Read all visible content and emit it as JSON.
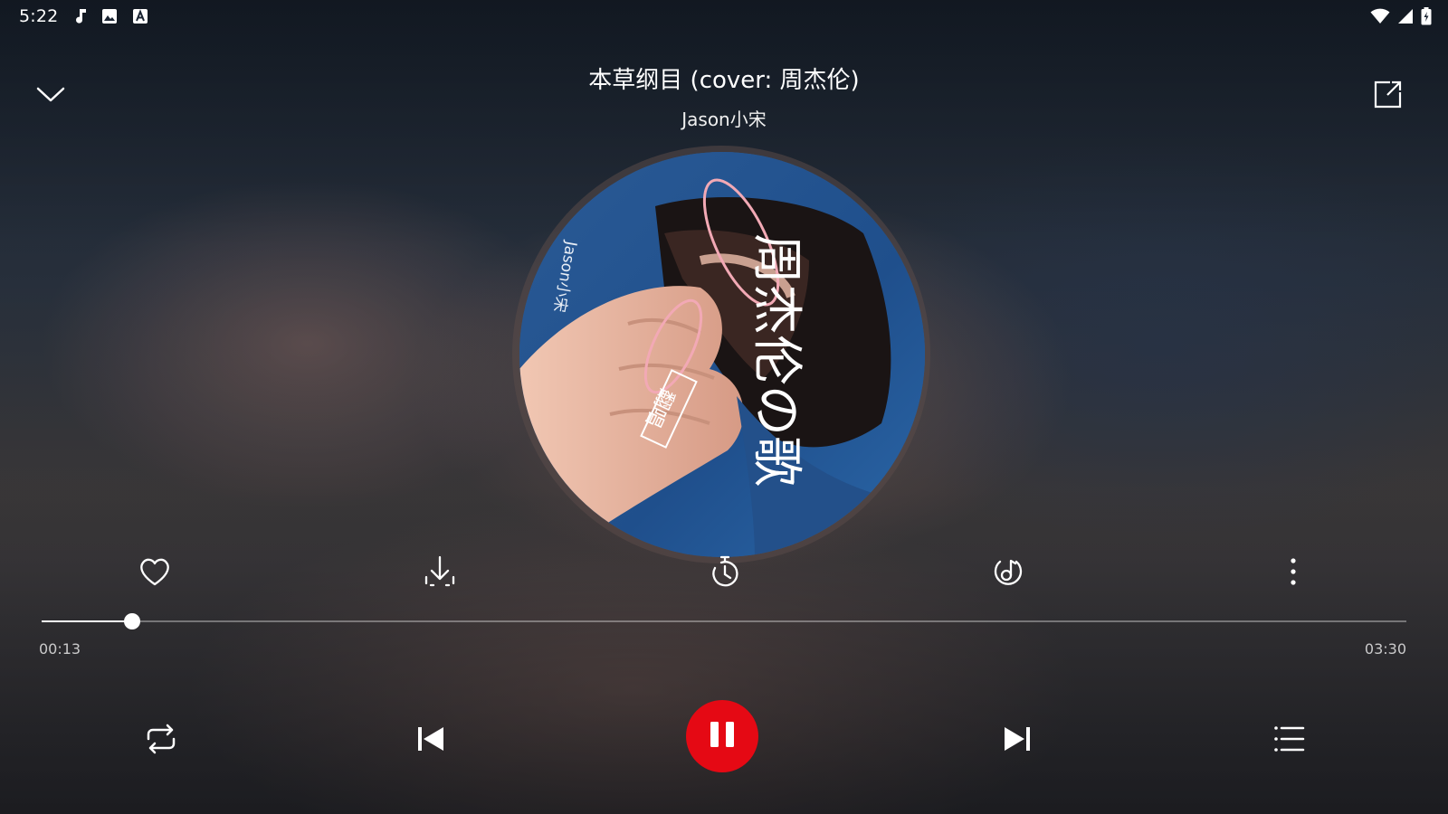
{
  "status_bar": {
    "time": "5:22",
    "left_icons": [
      "music-note-icon",
      "image-icon",
      "font-icon"
    ],
    "right_icons": [
      "wifi-icon",
      "cellular-signal-icon",
      "battery-charging-icon"
    ]
  },
  "header": {
    "title": "本草纲目 (cover: 周杰伦)",
    "artist": "Jason小宋",
    "collapse_icon": "chevron-down-icon",
    "share_icon": "external-link-icon"
  },
  "album": {
    "art_text_main": "周杰伦の歌",
    "art_text_artist": "Jason小宋",
    "art_text_stamp": "翻唱"
  },
  "actions": [
    {
      "name": "like-button",
      "icon": "heart-outline-icon"
    },
    {
      "name": "download-button",
      "icon": "download-icon"
    },
    {
      "name": "sleep-timer-button",
      "icon": "timer-icon"
    },
    {
      "name": "sound-effect-button",
      "icon": "music-note-circle-icon"
    },
    {
      "name": "more-button",
      "icon": "more-vertical-icon"
    }
  ],
  "progress": {
    "current_time": "00:13",
    "total_time": "03:30",
    "fraction": 0.066
  },
  "controls": {
    "repeat_icon": "repeat-icon",
    "previous_icon": "skip-previous-icon",
    "play_pause_icon": "pause-icon",
    "next_icon": "skip-next-icon",
    "playlist_icon": "playlist-icon",
    "play_button_color": "#e50914"
  }
}
